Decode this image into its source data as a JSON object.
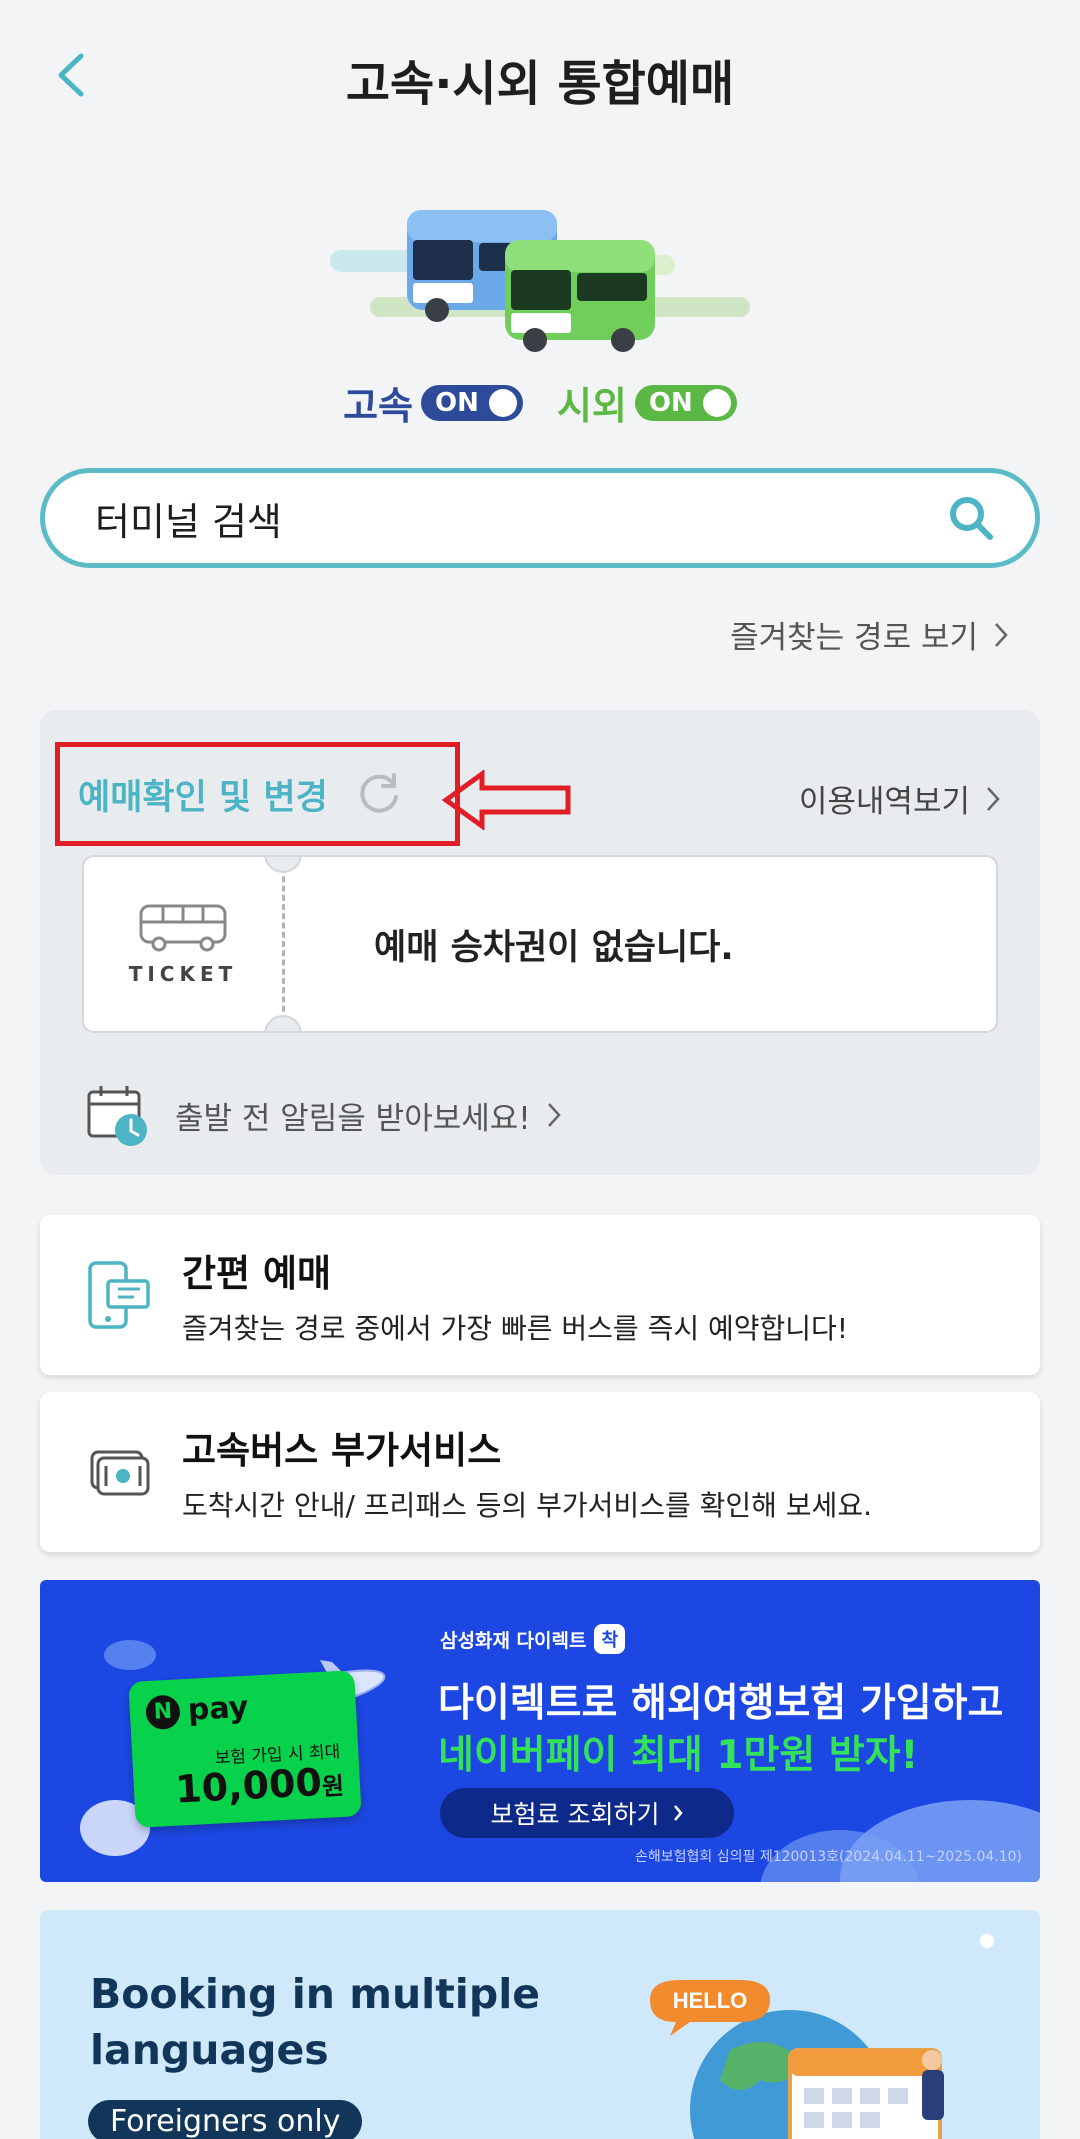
{
  "header": {
    "title": "고속·시외 통합예매"
  },
  "toggles": {
    "express": {
      "label": "고속",
      "state": "ON"
    },
    "intercity": {
      "label": "시외",
      "state": "ON"
    }
  },
  "search": {
    "placeholder": "터미널 검색"
  },
  "favorites_link": "즐겨찾는 경로 보기",
  "ticket_panel": {
    "confirm_label": "예매확인 및 변경",
    "history_link": "이용내역보기",
    "ticket_word": "TICKET",
    "empty_message": "예매 승차권이 없습니다.",
    "alarm_text": "출발 전 알림을 받아보세요!"
  },
  "services": [
    {
      "title": "간편 예매",
      "desc": "즐겨찾는 경로 중에서 가장 빠른 버스를 즉시 예약합니다!"
    },
    {
      "title": "고속버스 부가서비스",
      "desc": "도착시간 안내/ 프리패스 등의 부가서비스를 확인해 보세요."
    }
  ],
  "ad_banner": {
    "brand": "삼성화재 다이렉트",
    "brand_badge": "착",
    "npay_word": "pay",
    "npay_sub": "보험 가입 시 최대",
    "npay_amount": "10,000",
    "npay_unit": "원",
    "title_line1": "다이렉트로 해외여행보험 가입하고",
    "title_line2": "네이버페이 최대 1만원 받자!",
    "button": "보험료 조회하기",
    "note": "손해보험협회 심의필 제120013호(2024.04.11~2025.04.10)"
  },
  "lang_banner": {
    "title": "Booking in multiple languages",
    "pill": "Foreigners only",
    "bubble": "HELLO"
  },
  "colors": {
    "accent": "#5bbcc8",
    "express": "#2e4a9a",
    "intercity": "#5cb844",
    "highlight_box": "#e01e26",
    "ad_blue": "#1d47e2"
  }
}
